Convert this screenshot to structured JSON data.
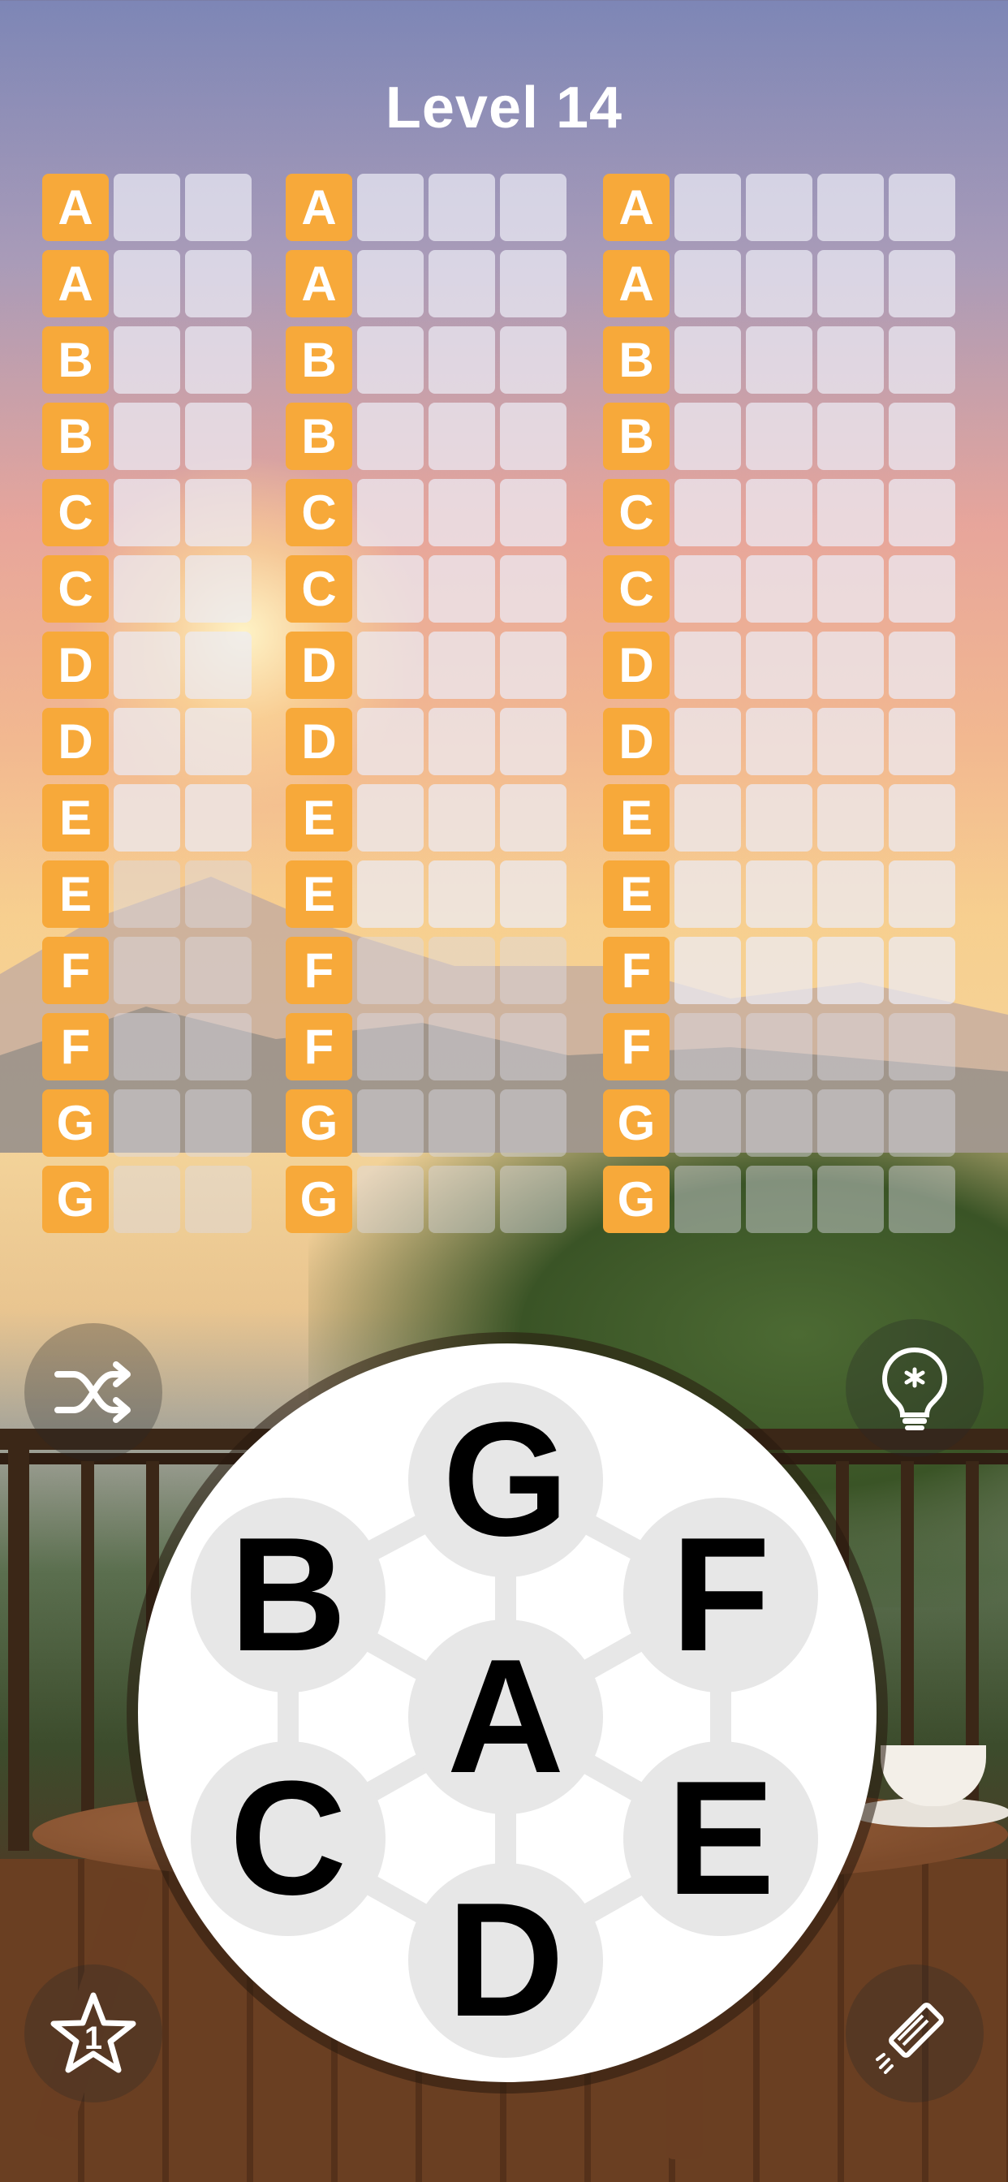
{
  "header": {
    "title": "Level 14"
  },
  "grid": {
    "columns": [
      {
        "letters": [
          "A",
          "A",
          "B",
          "B",
          "C",
          "C",
          "D",
          "D",
          "E",
          "E",
          "F",
          "F",
          "G",
          "G"
        ],
        "empty_cells": 2
      },
      {
        "letters": [
          "A",
          "A",
          "B",
          "B",
          "C",
          "C",
          "D",
          "D",
          "E",
          "E",
          "F",
          "F",
          "G",
          "G"
        ],
        "empty_cells": 3
      },
      {
        "letters": [
          "A",
          "A",
          "B",
          "B",
          "C",
          "C",
          "D",
          "D",
          "E",
          "E",
          "F",
          "F",
          "G",
          "G"
        ],
        "empty_cells": 4
      }
    ]
  },
  "wheel": {
    "letters": {
      "top": "G",
      "upper_left": "B",
      "upper_right": "F",
      "center": "A",
      "lower_left": "C",
      "lower_right": "E",
      "bottom": "D"
    }
  },
  "buttons": {
    "shuffle": {
      "icon": "shuffle-icon"
    },
    "hint": {
      "icon": "lightbulb-icon"
    },
    "star": {
      "icon": "star-icon",
      "count": "1"
    },
    "rocket": {
      "icon": "firework-icon"
    }
  },
  "colors": {
    "filled_tile": "#f7a93a",
    "empty_tile": "#ebebf5"
  }
}
